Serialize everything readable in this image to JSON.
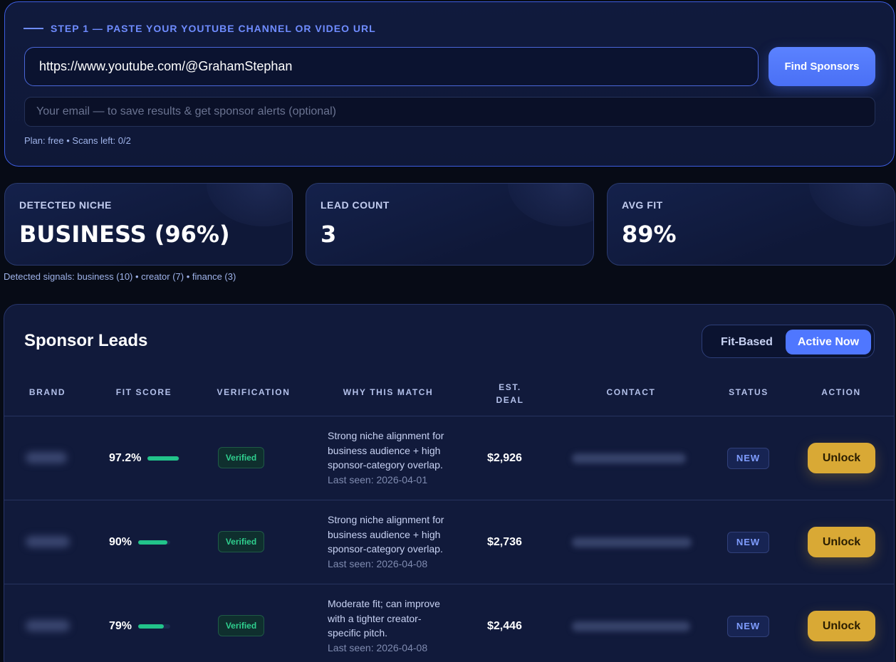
{
  "step": {
    "label": "STEP 1 — PASTE YOUR YOUTUBE CHANNEL OR VIDEO URL",
    "url_value": "https://www.youtube.com/@GrahamStephan",
    "find_button": "Find Sponsors",
    "email_placeholder": "Your email — to save results & get sponsor alerts (optional)",
    "plan_text": "Plan: free • Scans left: 0/2"
  },
  "stats": [
    {
      "label": "DETECTED NICHE",
      "value": "BUSINESS (96%)"
    },
    {
      "label": "LEAD COUNT",
      "value": "3"
    },
    {
      "label": "AVG FIT",
      "value": "89%"
    }
  ],
  "signals": "Detected signals: business (10) • creator (7) • finance (3)",
  "leads": {
    "title": "Sponsor Leads",
    "toggle": {
      "fit_based": "Fit-Based",
      "active_now": "Active Now",
      "selected": "Active Now"
    },
    "columns": {
      "brand": "BRAND",
      "fit_score": "FIT SCORE",
      "verification": "VERIFICATION",
      "why": "WHY THIS MATCH",
      "deal_line1": "EST.",
      "deal_line2": "DEAL",
      "contact": "CONTACT",
      "status": "STATUS",
      "action": "ACTION"
    },
    "rows": [
      {
        "fit": "97.2%",
        "fit_value": 0.972,
        "verification": "Verified",
        "why": "Strong niche alignment for business audience + high sponsor-category overlap.",
        "last_seen": "Last seen: 2026-04-01",
        "deal": "$2,926",
        "status": "NEW",
        "action": "Unlock"
      },
      {
        "fit": "90%",
        "fit_value": 0.9,
        "verification": "Verified",
        "why": "Strong niche alignment for business audience + high sponsor-category overlap.",
        "last_seen": "Last seen: 2026-04-08",
        "deal": "$2,736",
        "status": "NEW",
        "action": "Unlock"
      },
      {
        "fit": "79%",
        "fit_value": 0.79,
        "verification": "Verified",
        "why": "Moderate fit; can improve with a tighter creator-specific pitch.",
        "last_seen": "Last seen: 2026-04-08",
        "deal": "$2,446",
        "status": "NEW",
        "action": "Unlock"
      }
    ]
  },
  "colors": {
    "accent": "#4f77ff",
    "success": "#22c38a",
    "unlock": "#d9a935",
    "background": "#070b16"
  }
}
